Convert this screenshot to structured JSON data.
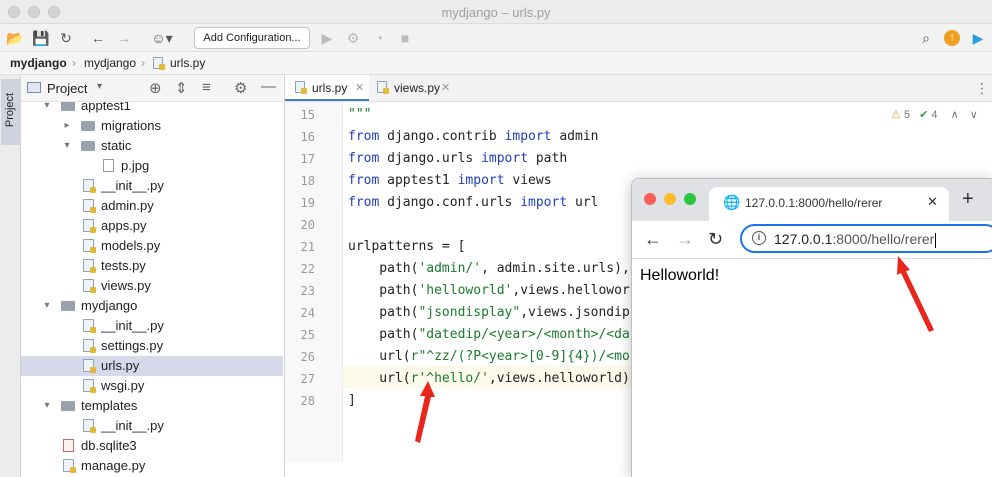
{
  "window": {
    "title": "mydjango – urls.py"
  },
  "toolbar": {
    "add_configuration": "Add Configuration..."
  },
  "breadcrumb": [
    "mydjango",
    "mydjango",
    "urls.py"
  ],
  "sidebar": {
    "tab_label": "Project"
  },
  "project_panel": {
    "dropdown": "Project"
  },
  "tree": [
    {
      "label": "apptest1",
      "type": "folder",
      "depth": 2,
      "expanded": true
    },
    {
      "label": "migrations",
      "type": "folder",
      "depth": 3,
      "expanded": false
    },
    {
      "label": "static",
      "type": "folder",
      "depth": 3,
      "expanded": true
    },
    {
      "label": "p.jpg",
      "type": "image",
      "depth": 4
    },
    {
      "label": "__init__.py",
      "type": "py",
      "depth": 3
    },
    {
      "label": "admin.py",
      "type": "py",
      "depth": 3
    },
    {
      "label": "apps.py",
      "type": "py",
      "depth": 3
    },
    {
      "label": "models.py",
      "type": "py",
      "depth": 3
    },
    {
      "label": "tests.py",
      "type": "py",
      "depth": 3
    },
    {
      "label": "views.py",
      "type": "py",
      "depth": 3
    },
    {
      "label": "mydjango",
      "type": "folder",
      "depth": 2,
      "expanded": true
    },
    {
      "label": "__init__.py",
      "type": "py",
      "depth": 3
    },
    {
      "label": "settings.py",
      "type": "py",
      "depth": 3
    },
    {
      "label": "urls.py",
      "type": "py",
      "depth": 3,
      "selected": true
    },
    {
      "label": "wsgi.py",
      "type": "py",
      "depth": 3
    },
    {
      "label": "templates",
      "type": "folder",
      "depth": 2,
      "expanded": true
    },
    {
      "label": "__init__.py",
      "type": "py",
      "depth": 3
    },
    {
      "label": "db.sqlite3",
      "type": "db",
      "depth": 2
    },
    {
      "label": "manage.py",
      "type": "py",
      "depth": 2
    }
  ],
  "editor_tabs": [
    {
      "label": "urls.py",
      "active": true
    },
    {
      "label": "views.py",
      "active": false
    }
  ],
  "inspections": {
    "warnings": "5",
    "checks": "4"
  },
  "code_lines": [
    {
      "n": "15",
      "t": [
        [
          "\"\"\"",
          "st"
        ]
      ]
    },
    {
      "n": "16",
      "t": [
        [
          "from",
          "kw"
        ],
        [
          " django.contrib ",
          ""
        ],
        [
          "import",
          "kw"
        ],
        [
          " admin",
          ""
        ]
      ]
    },
    {
      "n": "17",
      "t": [
        [
          "from",
          "kw"
        ],
        [
          " django.urls ",
          ""
        ],
        [
          "import",
          "kw"
        ],
        [
          " path",
          ""
        ]
      ]
    },
    {
      "n": "18",
      "t": [
        [
          "from",
          "kw"
        ],
        [
          " apptest1 ",
          ""
        ],
        [
          "import",
          "kw"
        ],
        [
          " views",
          ""
        ]
      ]
    },
    {
      "n": "19",
      "t": [
        [
          "from",
          "kw"
        ],
        [
          " django.conf.urls ",
          ""
        ],
        [
          "import",
          "kw"
        ],
        [
          " url",
          ""
        ]
      ]
    },
    {
      "n": "20",
      "t": []
    },
    {
      "n": "21",
      "t": [
        [
          "urlpatterns = [",
          ""
        ]
      ]
    },
    {
      "n": "22",
      "t": [
        [
          "    path(",
          ""
        ],
        [
          "'admin/'",
          "st"
        ],
        [
          ", admin.site.urls),",
          ""
        ]
      ]
    },
    {
      "n": "23",
      "t": [
        [
          "    path(",
          ""
        ],
        [
          "'helloworld'",
          "st"
        ],
        [
          ",views.hellowor",
          ""
        ]
      ]
    },
    {
      "n": "24",
      "t": [
        [
          "    path(",
          ""
        ],
        [
          "\"jsondisplay\"",
          "st"
        ],
        [
          ",views.jsondip",
          ""
        ]
      ]
    },
    {
      "n": "25",
      "t": [
        [
          "    path(",
          ""
        ],
        [
          "\"datedip/<year>/<month>/<da",
          "st"
        ]
      ]
    },
    {
      "n": "26",
      "t": [
        [
          "    url(",
          ""
        ],
        [
          "r\"^zz/(?P<year>[0-9]{4})/<mo",
          "st"
        ]
      ]
    },
    {
      "n": "27",
      "t": [
        [
          "    url(",
          ""
        ],
        [
          "r'^hello/'",
          "st"
        ],
        [
          ",views.helloworld)",
          ""
        ]
      ]
    },
    {
      "n": "28",
      "t": [
        [
          "]",
          ""
        ]
      ]
    }
  ],
  "browser": {
    "tab_title": "127.0.0.1:8000/hello/rerer",
    "url_host": "127.0.0.1",
    "url_rest": ":8000/hello/rerer",
    "content": "Helloworld!"
  }
}
